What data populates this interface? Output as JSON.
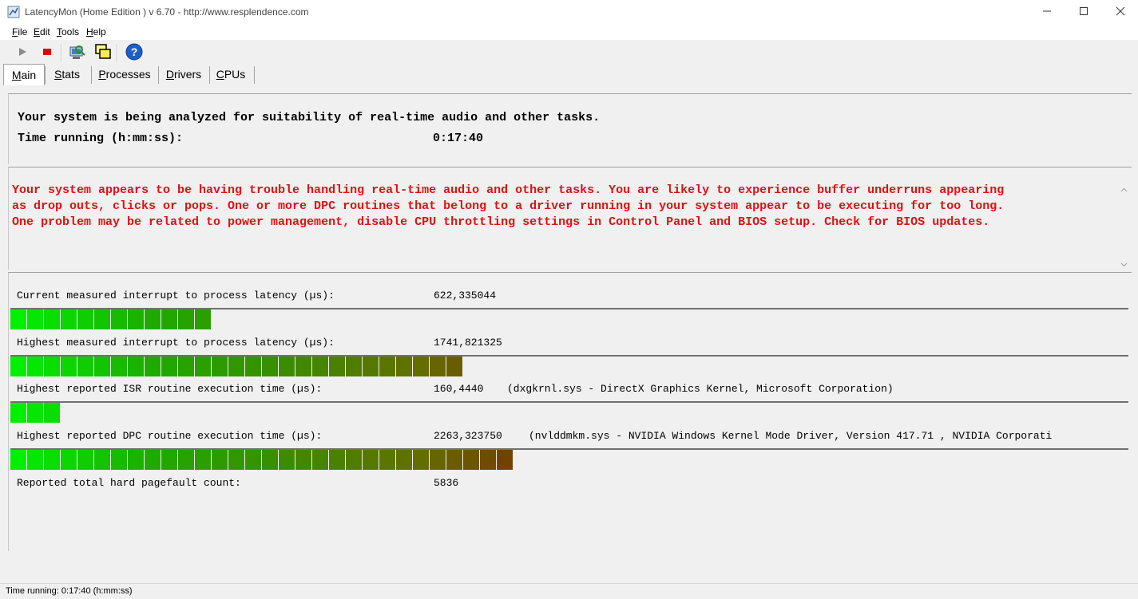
{
  "window": {
    "title": "LatencyMon  (Home Edition )  v 6.70 - http://www.resplendence.com",
    "minimize_icon": "minimize-icon",
    "maximize_icon": "maximize-icon",
    "close_icon": "close-icon"
  },
  "menu": {
    "items": [
      {
        "ul": "F",
        "rest": "ile"
      },
      {
        "ul": "E",
        "rest": "dit"
      },
      {
        "ul": "T",
        "rest": "ools"
      },
      {
        "ul": "H",
        "rest": "elp"
      }
    ]
  },
  "toolbar": {
    "icons": [
      "play-icon",
      "stop-icon",
      "analyze-icon",
      "windows-icon",
      "help-icon"
    ]
  },
  "tabs": {
    "items": [
      {
        "ul": "M",
        "rest": "ain"
      },
      {
        "ul": "S",
        "rest": "tats"
      },
      {
        "ul": "P",
        "rest": "rocesses"
      },
      {
        "ul": "D",
        "rest": "rivers"
      },
      {
        "ul": "C",
        "rest": "PUs"
      }
    ],
    "active": 0
  },
  "summary": {
    "line1": "Your system is being analyzed for suitability of real-time audio and other tasks.",
    "time_label": "Time running (h:mm:ss):",
    "time_value": "0:17:40"
  },
  "message": {
    "line1": "Your system appears to be having trouble handling real-time audio and other tasks. You are likely to experience buffer underruns appearing",
    "line2": "as drop outs, clicks or pops. One or more DPC routines that belong to a driver running in your system appear to be executing for too long.",
    "line3": "One problem may be related to power management, disable CPU throttling settings in Control Panel and BIOS setup. Check for BIOS updates.",
    "color": "#e01010"
  },
  "metrics": [
    {
      "label": "Current measured interrupt to process latency (µs):",
      "value": "622,335044",
      "detail": "",
      "segments": 12
    },
    {
      "label": "Highest measured interrupt to process latency (µs):",
      "value": "1741,821325",
      "detail": "",
      "segments": 27
    },
    {
      "label": "Highest reported ISR routine execution time (µs):",
      "value": "160,4440",
      "detail": "(dxgkrnl.sys - DirectX Graphics Kernel, Microsoft Corporation)",
      "segments": 3
    },
    {
      "label": "Highest reported DPC routine execution time (µs):",
      "value": "2263,323750",
      "detail": "(nvlddmkm.sys - NVIDIA Windows Kernel Mode Driver, Version 417.71 , NVIDIA Corporati",
      "segments": 30
    }
  ],
  "pagefault": {
    "label": "Reported total hard pagefault count:",
    "value": "5836"
  },
  "status": {
    "text": "Time running: 0:17:40  (h:mm:ss)"
  }
}
